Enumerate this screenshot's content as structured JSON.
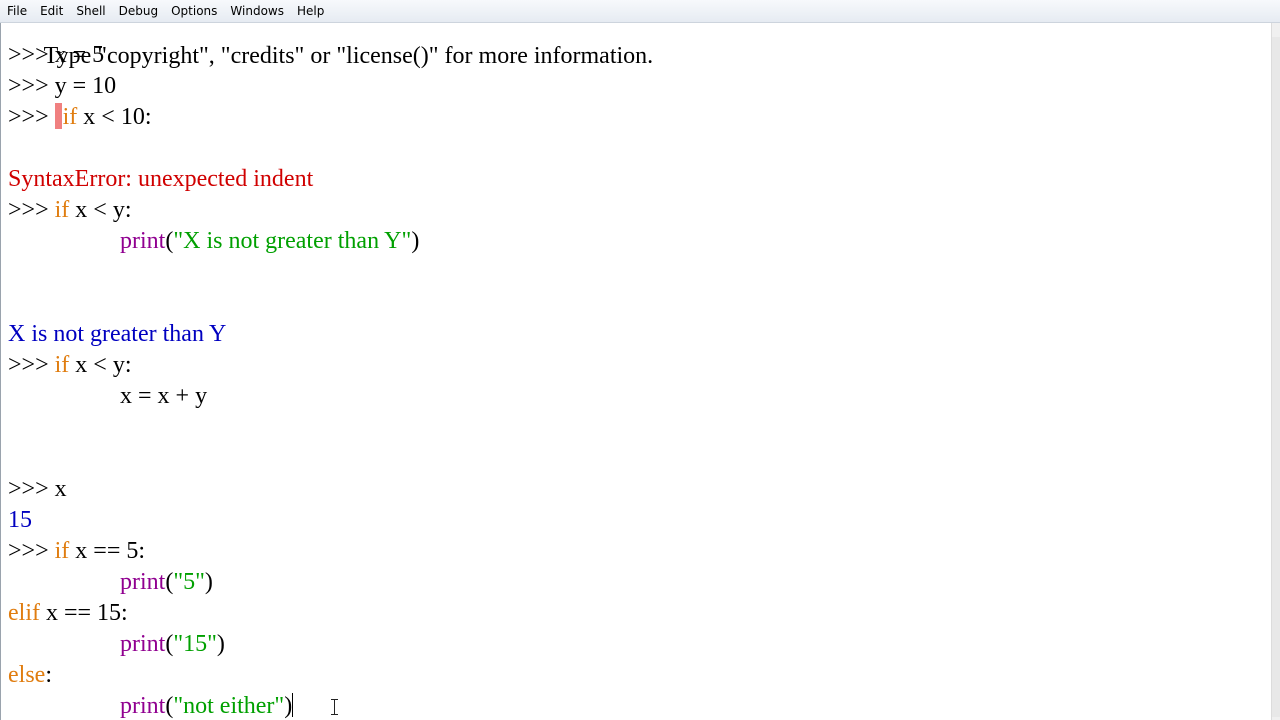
{
  "menu": [
    "File",
    "Edit",
    "Shell",
    "Debug",
    "Options",
    "Windows",
    "Help"
  ],
  "prompt": ">>>",
  "lines": {
    "l0": "Type \"copyright\", \"credits\" or \"license()\" for more information.",
    "l1_code": "x = 5",
    "l2_code": "y = 10",
    "l3_kw": "if",
    "l3_code": " x < 10:",
    "l5_err": "SyntaxError: unexpected indent",
    "l6_kw": "if",
    "l6_code": " x < y:",
    "l7_bi": "print",
    "l7_open": "(",
    "l7_str": "\"X is not greater than Y\"",
    "l7_close": ")",
    "l10_out": "X is not greater than Y",
    "l11_kw": "if",
    "l11_code": " x < y:",
    "l12_code": "x = x + y",
    "l15_code": "x",
    "l16_out": "15",
    "l17_kw": "if",
    "l17_code": " x == 5:",
    "l18_bi": "print",
    "l18_open": "(",
    "l18_str": "\"5\"",
    "l18_close": ")",
    "l19_kw": "elif",
    "l19_code": " x == 15:",
    "l20_bi": "print",
    "l20_open": "(",
    "l20_str": "\"15\"",
    "l20_close": ")",
    "l21_kw": "else",
    "l21_code": ":",
    "l22_bi": "print",
    "l22_open": "(",
    "l22_str": "\"not either\"",
    "l22_close": ")"
  },
  "colors": {
    "keyword": "#e07d10",
    "builtin": "#900090",
    "string": "#00a000",
    "output": "#0000c0",
    "error": "#d00000"
  }
}
